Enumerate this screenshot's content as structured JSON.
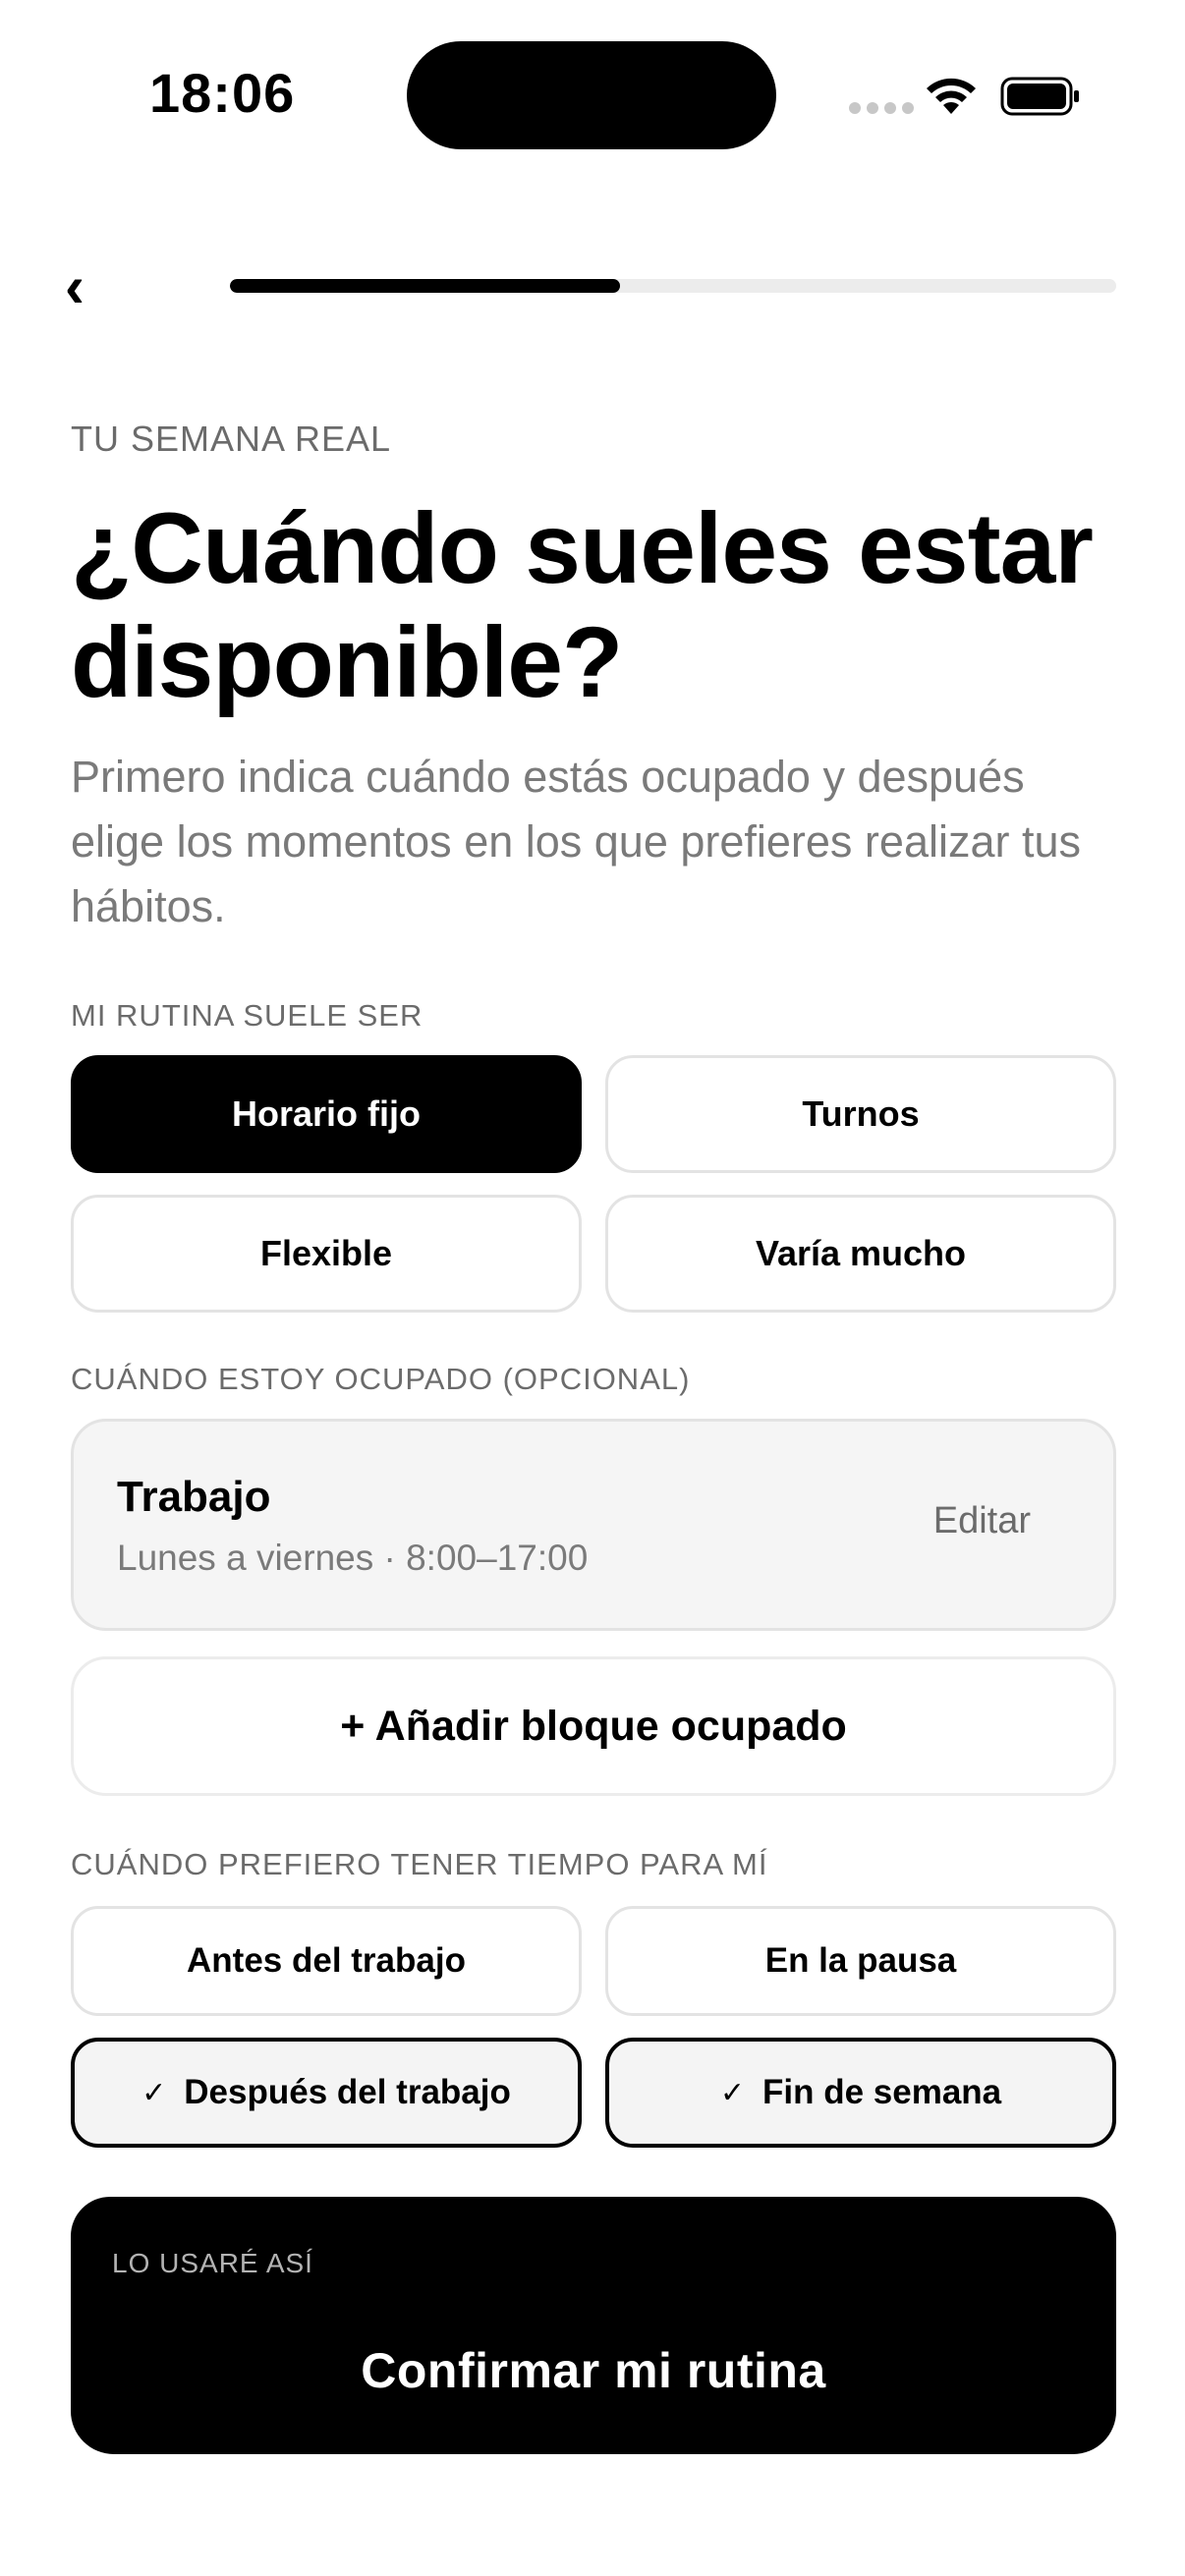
{
  "status_bar": {
    "time": "18:06"
  },
  "progress": {
    "fraction": 0.44
  },
  "header": {
    "kicker": "TU SEMANA REAL",
    "title": "¿Cuándo sueles estar disponible?",
    "subtitle": "Primero indica cuándo estás ocupado y después elige los momentos en los que prefieres realizar tus hábitos."
  },
  "routine": {
    "label": "MI RUTINA SUELE SER",
    "options": [
      {
        "label": "Horario fijo",
        "selected": true
      },
      {
        "label": "Turnos",
        "selected": false
      },
      {
        "label": "Flexible",
        "selected": false
      },
      {
        "label": "Varía mucho",
        "selected": false
      }
    ]
  },
  "busy": {
    "label": "CUÁNDO ESTOY OCUPADO (OPCIONAL)",
    "block": {
      "title": "Trabajo",
      "schedule": "Lunes a viernes · 8:00–17:00",
      "edit_label": "Editar"
    },
    "add_label": "+ Añadir bloque ocupado"
  },
  "preferences": {
    "label": "CUÁNDO PREFIERO TENER TIEMPO PARA MÍ",
    "options": [
      {
        "label": "Antes del trabajo",
        "checked": false
      },
      {
        "label": "En la pausa",
        "checked": false
      },
      {
        "label": "Después del trabajo",
        "checked": true
      },
      {
        "label": "Fin de semana",
        "checked": true
      }
    ],
    "check_glyph": "✓"
  },
  "summary": {
    "label": "LO USARÉ ASÍ"
  },
  "confirm_label": "Confirmar mi rutina",
  "colors": {
    "accent": "#000000",
    "muted_text": "#7a7a7a",
    "card_bg": "#f5f5f5",
    "border": "#e3e3e3"
  }
}
